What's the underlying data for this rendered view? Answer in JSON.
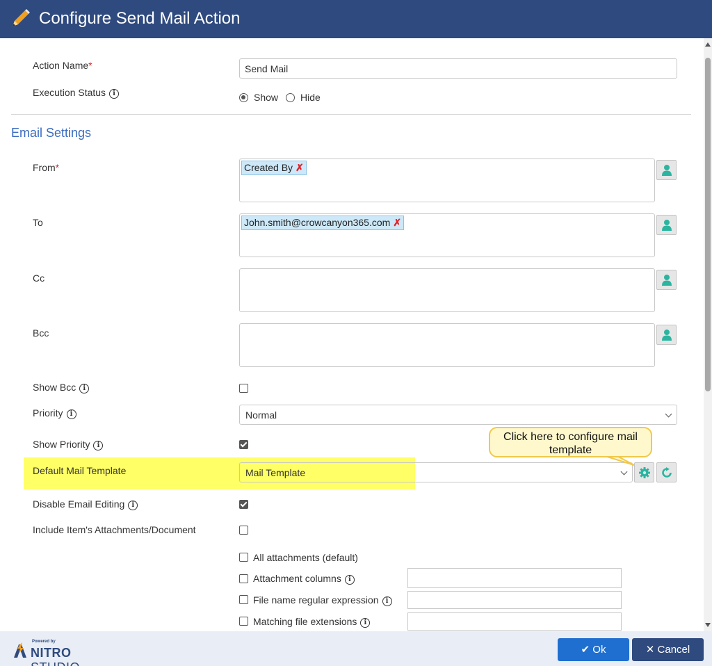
{
  "window": {
    "title": "Configure Send Mail Action"
  },
  "form": {
    "action_name": {
      "label": "Action Name",
      "required_mark": "*",
      "value": "Send Mail"
    },
    "execution_status": {
      "label": "Execution Status",
      "options": [
        "Show",
        "Hide"
      ],
      "selected": "Show"
    }
  },
  "email_settings": {
    "section_title": "Email Settings",
    "from": {
      "label": "From",
      "required_mark": "*",
      "token": "Created By",
      "remove_glyph": "✗"
    },
    "to": {
      "label": "To",
      "token": "John.smith@crowcanyon365.com",
      "remove_glyph": "✗"
    },
    "cc": {
      "label": "Cc"
    },
    "bcc": {
      "label": "Bcc"
    },
    "show_bcc": {
      "label": "Show Bcc",
      "checked": false
    },
    "priority": {
      "label": "Priority",
      "value": "Normal"
    },
    "show_priority": {
      "label": "Show Priority",
      "checked": true
    },
    "default_mail_template": {
      "label": "Default Mail Template",
      "value": "Mail Template"
    },
    "callout": "Click here to configure mail template",
    "disable_email_editing": {
      "label": "Disable Email Editing",
      "checked": true
    },
    "include_attachments": {
      "label": "Include Item's Attachments/Document",
      "checked": false
    },
    "attachment_options": {
      "all": "All attachments (default)",
      "columns": "Attachment columns",
      "regex": "File name regular expression",
      "extensions": "Matching file extensions"
    }
  },
  "footer": {
    "powered_by": "Powered by",
    "brand_bold": "NITRO",
    "brand_light": " STUDIO",
    "ok_label": "Ok",
    "cancel_label": "Cancel"
  },
  "icons": {
    "info": "info-icon",
    "person": "person-picker-icon",
    "gear": "gear-icon",
    "refresh": "refresh-icon",
    "pencil": "pencil-icon"
  },
  "colors": {
    "title_bar": "#2f4a7e",
    "section_title": "#3b6cc0",
    "ok_button": "#1f6fd0",
    "highlight": "#ffff66",
    "person_icon": "#2bb5a0"
  }
}
